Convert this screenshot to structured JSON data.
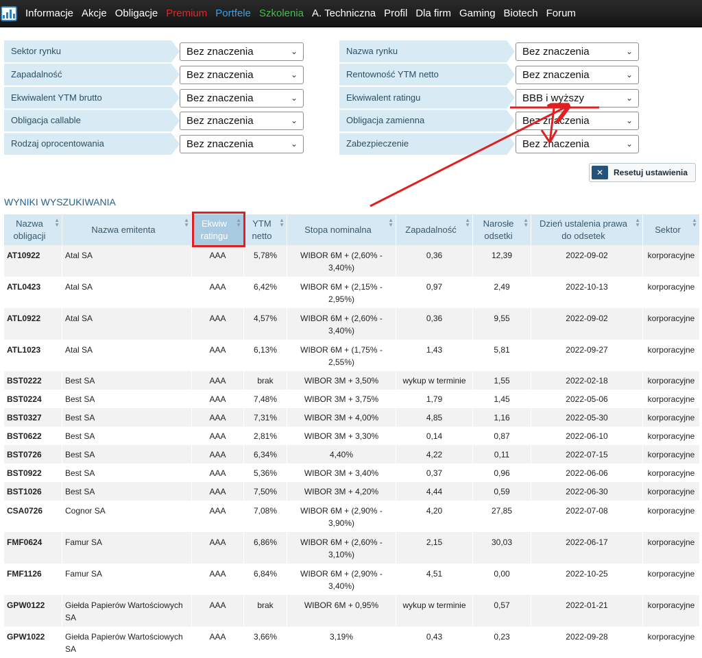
{
  "nav": {
    "items": [
      {
        "label": "Informacje",
        "color": "#ffffff"
      },
      {
        "label": "Akcje",
        "color": "#ffffff"
      },
      {
        "label": "Obligacje",
        "color": "#ffffff"
      },
      {
        "label": "Premium",
        "color": "#e32626"
      },
      {
        "label": "Portfele",
        "color": "#3aa0e6"
      },
      {
        "label": "Szkolenia",
        "color": "#3fc14a"
      },
      {
        "label": "A. Techniczna",
        "color": "#ffffff"
      },
      {
        "label": "Profil",
        "color": "#ffffff"
      },
      {
        "label": "Dla firm",
        "color": "#ffffff"
      },
      {
        "label": "Gaming",
        "color": "#ffffff"
      },
      {
        "label": "Biotech",
        "color": "#ffffff"
      },
      {
        "label": "Forum",
        "color": "#ffffff"
      }
    ]
  },
  "filters": {
    "left": [
      {
        "label": "Sektor rynku",
        "value": "Bez znaczenia"
      },
      {
        "label": "Zapadalność",
        "value": "Bez znaczenia"
      },
      {
        "label": "Ekwiwalent YTM brutto",
        "value": "Bez znaczenia"
      },
      {
        "label": "Obligacja callable",
        "value": "Bez znaczenia"
      },
      {
        "label": "Rodzaj oprocentowania",
        "value": "Bez znaczenia"
      }
    ],
    "right": [
      {
        "label": "Nazwa rynku",
        "value": "Bez znaczenia"
      },
      {
        "label": "Rentowność YTM netto",
        "value": "Bez znaczenia"
      },
      {
        "label": "Ekwiwalent ratingu",
        "value": "BBB i wyższy"
      },
      {
        "label": "Obligacja zamienna",
        "value": "Bez znaczenia"
      },
      {
        "label": "Zabezpieczenie",
        "value": "Bez znaczenia"
      }
    ],
    "reset_label": "Resetuj ustawienia"
  },
  "results": {
    "title": "WYNIKI WYSZUKIWANIA",
    "columns": [
      "Nazwa obligacji",
      "Nazwa emitenta",
      "Ekwiw ratingu",
      "YTM netto",
      "Stopa nominalna",
      "Zapadalność",
      "Narosłe odsetki",
      "Dzień ustalenia prawa do odsetek",
      "Sektor"
    ],
    "rows": [
      [
        "AT10922",
        "Atal SA",
        "AAA",
        "5,78%",
        "WIBOR 6M + (2,60% - 3,40%)",
        "0,36",
        "12,39",
        "2022-09-02",
        "korporacyjne"
      ],
      [
        "ATL0423",
        "Atal SA",
        "AAA",
        "6,42%",
        "WIBOR 6M + (2,15% - 2,95%)",
        "0,97",
        "2,49",
        "2022-10-13",
        "korporacyjne"
      ],
      [
        "ATL0922",
        "Atal SA",
        "AAA",
        "4,57%",
        "WIBOR 6M + (2,60% - 3,40%)",
        "0,36",
        "9,55",
        "2022-09-02",
        "korporacyjne"
      ],
      [
        "ATL1023",
        "Atal SA",
        "AAA",
        "6,13%",
        "WIBOR 6M + (1,75% - 2,55%)",
        "1,43",
        "5,81",
        "2022-09-27",
        "korporacyjne"
      ],
      [
        "BST0222",
        "Best SA",
        "AAA",
        "brak",
        "WIBOR 3M + 3,50%",
        "wykup w terminie",
        "1,55",
        "2022-02-18",
        "korporacyjne"
      ],
      [
        "BST0224",
        "Best SA",
        "AAA",
        "7,48%",
        "WIBOR 3M + 3,75%",
        "1,79",
        "1,45",
        "2022-05-06",
        "korporacyjne"
      ],
      [
        "BST0327",
        "Best SA",
        "AAA",
        "7,31%",
        "WIBOR 3M + 4,00%",
        "4,85",
        "1,16",
        "2022-05-30",
        "korporacyjne"
      ],
      [
        "BST0622",
        "Best SA",
        "AAA",
        "2,81%",
        "WIBOR 3M + 3,30%",
        "0,14",
        "0,87",
        "2022-06-10",
        "korporacyjne"
      ],
      [
        "BST0726",
        "Best SA",
        "AAA",
        "6,34%",
        "4,40%",
        "4,22",
        "0,11",
        "2022-07-15",
        "korporacyjne"
      ],
      [
        "BST0922",
        "Best SA",
        "AAA",
        "5,36%",
        "WIBOR 3M + 3,40%",
        "0,37",
        "0,96",
        "2022-06-06",
        "korporacyjne"
      ],
      [
        "BST1026",
        "Best SA",
        "AAA",
        "7,50%",
        "WIBOR 3M + 4,20%",
        "4,44",
        "0,59",
        "2022-06-30",
        "korporacyjne"
      ],
      [
        "CSA0726",
        "Cognor SA",
        "AAA",
        "7,08%",
        "WIBOR 6M + (2,90% - 3,90%)",
        "4,20",
        "27,85",
        "2022-07-08",
        "korporacyjne"
      ],
      [
        "FMF0624",
        "Famur SA",
        "AAA",
        "6,86%",
        "WIBOR 6M + (2,60% - 3,10%)",
        "2,15",
        "30,03",
        "2022-06-17",
        "korporacyjne"
      ],
      [
        "FMF1126",
        "Famur SA",
        "AAA",
        "6,84%",
        "WIBOR 6M + (2,90% - 3,40%)",
        "4,51",
        "0,00",
        "2022-10-25",
        "korporacyjne"
      ],
      [
        "GPW0122",
        "Giełda Papierów Wartościowych SA",
        "AAA",
        "brak",
        "WIBOR 6M + 0,95%",
        "wykup w terminie",
        "0,57",
        "2022-01-21",
        "korporacyjne"
      ],
      [
        "GPW1022",
        "Giełda Papierów Wartościowych SA",
        "AAA",
        "3,66%",
        "3,19%",
        "0,43",
        "0,23",
        "2022-09-28",
        "korporacyjne"
      ]
    ]
  },
  "colors": {
    "nav_bg": "#1b1b1b",
    "label_bg": "#d8eaf3",
    "header_bg": "#d5e8f3",
    "sorted_header_bg": "#a9cbe2",
    "annotation": "#e02020",
    "title": "#22618d"
  }
}
